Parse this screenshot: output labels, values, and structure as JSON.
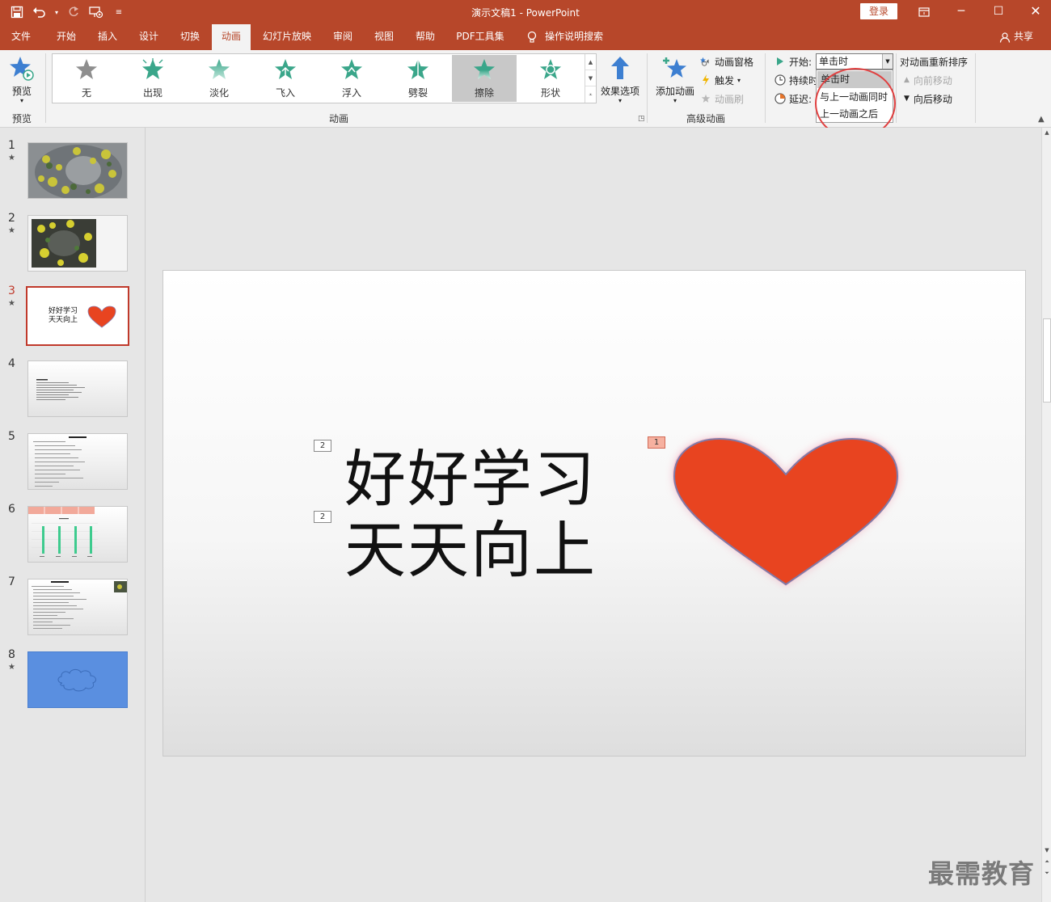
{
  "window": {
    "title": "演示文稿1  -  PowerPoint",
    "login_label": "登录",
    "controls": [
      "restore-ribbon",
      "minimize",
      "maximize",
      "close"
    ]
  },
  "tabs": [
    {
      "label": "文件"
    },
    {
      "label": "开始"
    },
    {
      "label": "插入"
    },
    {
      "label": "设计"
    },
    {
      "label": "切换"
    },
    {
      "label": "动画",
      "active": true
    },
    {
      "label": "幻灯片放映"
    },
    {
      "label": "审阅"
    },
    {
      "label": "视图"
    },
    {
      "label": "帮助"
    },
    {
      "label": "PDF工具集"
    }
  ],
  "tell_me": "操作说明搜索",
  "share": "共享",
  "ribbon": {
    "preview": {
      "button": "预览",
      "group": "预览"
    },
    "animation": {
      "group": "动画",
      "gallery": [
        {
          "label": "无",
          "icon": "star-gray-icon"
        },
        {
          "label": "出现",
          "icon": "star-appear-icon"
        },
        {
          "label": "淡化",
          "icon": "star-fade-icon"
        },
        {
          "label": "飞入",
          "icon": "star-fly-in-icon"
        },
        {
          "label": "浮入",
          "icon": "star-float-in-icon"
        },
        {
          "label": "劈裂",
          "icon": "star-split-icon"
        },
        {
          "label": "擦除",
          "icon": "star-wipe-icon",
          "selected": true
        },
        {
          "label": "形状",
          "icon": "star-shape-icon"
        }
      ],
      "effect_options": "效果选项"
    },
    "advanced": {
      "group": "高级动画",
      "add_animation": "添加动画",
      "animation_pane": "动画窗格",
      "trigger": "触发",
      "animation_painter": "动画刷"
    },
    "timing": {
      "start_label": "开始:",
      "start_value": "单击时",
      "duration_label": "持续时",
      "delay_label": "延迟:",
      "start_options": [
        "单击时",
        "与上一动画同时",
        "上一动画之后"
      ],
      "highlighted_option": "单击时"
    },
    "reorder": {
      "title": "对动画重新排序",
      "move_earlier": "向前移动",
      "move_later": "向后移动"
    }
  },
  "thumbnails": [
    {
      "number": "1",
      "star": true,
      "kind": "photo"
    },
    {
      "number": "2",
      "star": true,
      "kind": "photo-small"
    },
    {
      "number": "3",
      "star": true,
      "kind": "text-heart",
      "current": true,
      "text_line1": "好好学习",
      "text_line2": "天天向上"
    },
    {
      "number": "4",
      "star": false,
      "kind": "text-list"
    },
    {
      "number": "5",
      "star": false,
      "kind": "text-list"
    },
    {
      "number": "6",
      "star": false,
      "kind": "bar-chart"
    },
    {
      "number": "7",
      "star": false,
      "kind": "text-list-image"
    },
    {
      "number": "8",
      "star": true,
      "kind": "blue-cloud"
    }
  ],
  "slide": {
    "line1": "好好学习",
    "line2": "天天向上",
    "tags": {
      "line1_tag": "2",
      "line2_tag": "2",
      "heart_tag": "1"
    },
    "heart_color": "#e84420"
  },
  "watermark": "最需教育",
  "colors": {
    "accent": "#b7472a",
    "star_green": "#3aa68a"
  }
}
